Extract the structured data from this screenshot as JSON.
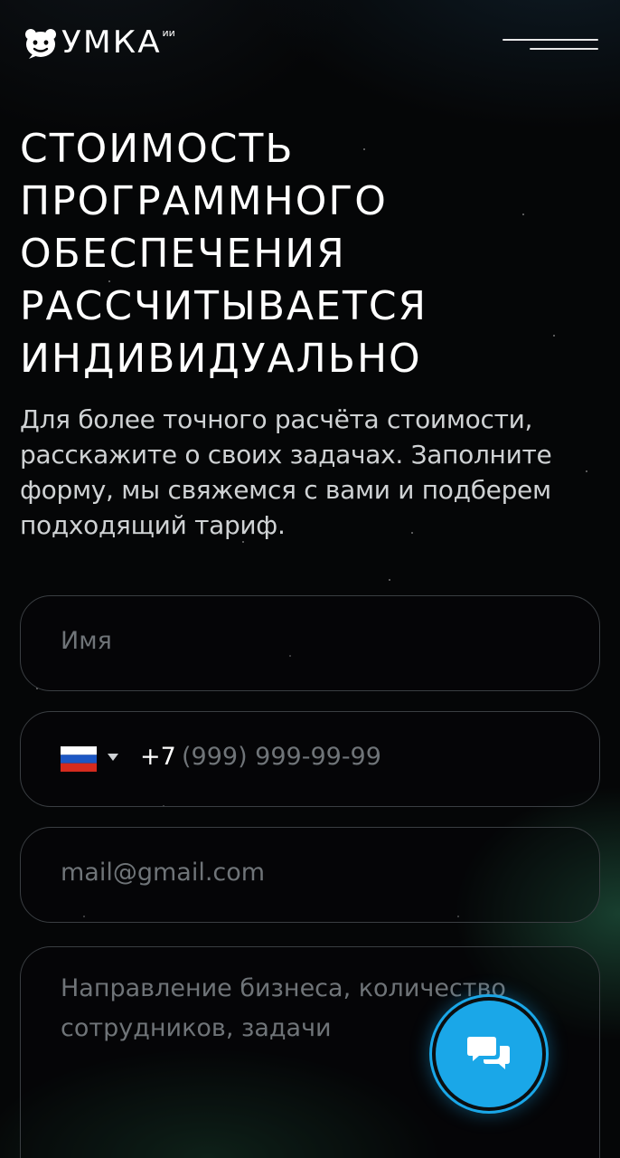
{
  "brand": {
    "name": "УМКА",
    "sup": "ии"
  },
  "hero": {
    "title_lines": [
      "СТОИМОСТЬ",
      "ПРОГРАММНОГО",
      "ОБЕСПЕЧЕНИЯ",
      "РАССЧИТЫВАЕТСЯ",
      "ИНДИВИДУАЛЬНО"
    ],
    "lead": "Для более точного расчёта стоимости, расскажите о своих задачах. Заполните форму, мы свяжемся с вами и подберем подходящий тариф."
  },
  "form": {
    "name": {
      "placeholder": "Имя",
      "value": ""
    },
    "phone": {
      "country_icon": "russia-flag-icon",
      "code": "+7",
      "placeholder": "(999) 999-99-99",
      "value": ""
    },
    "email": {
      "placeholder": "mail@gmail.com",
      "value": ""
    },
    "message": {
      "placeholder": "Направление бизнеса, количество сотрудников, задачи",
      "value": ""
    }
  },
  "chat": {
    "icon": "chat-bubbles-icon",
    "color": "#1aa7e8"
  },
  "menu": {
    "icon": "hamburger-menu-icon"
  }
}
